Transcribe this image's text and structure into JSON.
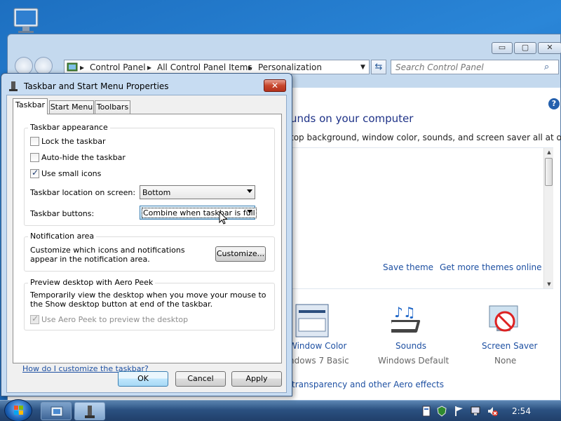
{
  "desktop": {
    "icon": "computer-icon"
  },
  "control_panel": {
    "caption_buttons": {
      "minimize": "▭",
      "maximize": "▢",
      "close": "✕"
    },
    "breadcrumb": [
      "Control Panel",
      "All Control Panel Items",
      "Personalization"
    ],
    "search_placeholder": "Search Control Panel",
    "heading": "unds on your computer",
    "description": "top background, window color, sounds, and screen saver all at once.",
    "save_theme": "Save theme",
    "get_more_themes": "Get more themes online",
    "items": [
      {
        "label": "Window Color",
        "sub": "ndows 7 Basic",
        "icon": "window-color-icon"
      },
      {
        "label": "Sounds",
        "sub": "Windows Default",
        "icon": "sounds-icon"
      },
      {
        "label": "Screen Saver",
        "sub": "None",
        "icon": "screen-saver-icon"
      }
    ],
    "aero_link": "transparency and other Aero effects"
  },
  "dialog": {
    "title": "Taskbar and Start Menu Properties",
    "close": "✕",
    "tabs": [
      "Taskbar",
      "Start Menu",
      "Toolbars"
    ],
    "appearance": {
      "title": "Taskbar appearance",
      "lock": {
        "label": "Lock the taskbar",
        "checked": false
      },
      "autohide": {
        "label": "Auto-hide the taskbar",
        "checked": false
      },
      "small_icons": {
        "label": "Use small icons",
        "checked": true
      },
      "location_label": "Taskbar location on screen:",
      "location_value": "Bottom",
      "buttons_label": "Taskbar buttons:",
      "buttons_value": "Combine when taskbar is full"
    },
    "notification": {
      "title": "Notification area",
      "text": "Customize which icons and notifications appear in the notification area.",
      "customize": "Customize..."
    },
    "peek": {
      "title": "Preview desktop with Aero Peek",
      "text": "Temporarily view the desktop when you move your mouse to the Show desktop button at end of the taskbar.",
      "checkbox": {
        "label": "Use Aero Peek to preview the desktop",
        "checked": true,
        "disabled": true
      }
    },
    "help_link": "How do I customize the taskbar?",
    "ok": "OK",
    "cancel": "Cancel",
    "apply": "Apply"
  },
  "taskbar": {
    "clock": "2:54",
    "tray_icons": [
      "document-icon",
      "shield-icon",
      "flag-icon",
      "network-icon",
      "volume-muted-icon"
    ]
  }
}
